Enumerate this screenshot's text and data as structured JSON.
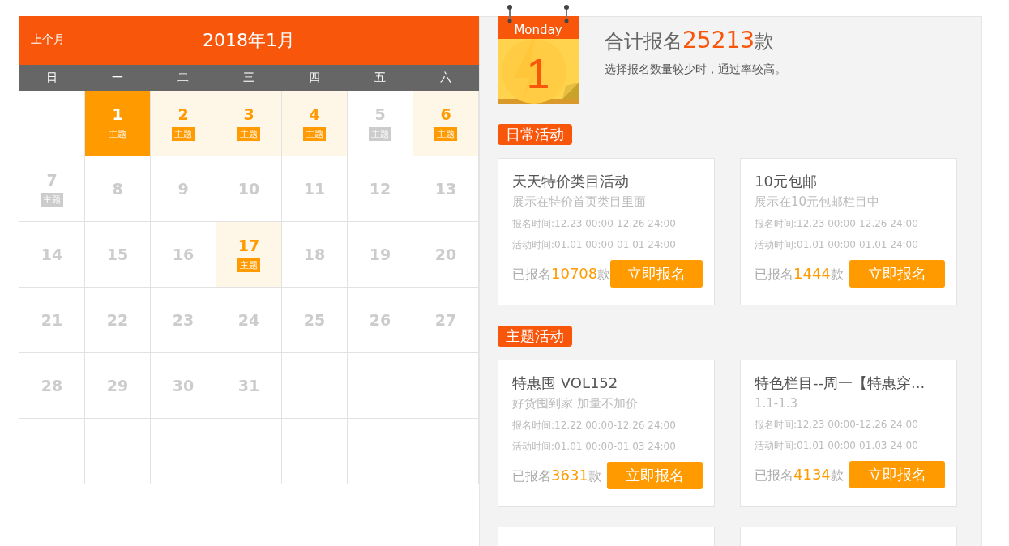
{
  "calendar": {
    "prev_link": "上个月",
    "title": "2018年1月",
    "weekdays": [
      "日",
      "一",
      "二",
      "三",
      "四",
      "五",
      "六"
    ],
    "weeks": [
      [
        {
          "kind": "blank"
        },
        {
          "kind": "day",
          "day": "1",
          "tag": "主题",
          "selected": true
        },
        {
          "kind": "day",
          "day": "2",
          "tag": "主题",
          "selected": false,
          "highlighted": true
        },
        {
          "kind": "day",
          "day": "3",
          "tag": "主题",
          "selected": false,
          "highlighted": true
        },
        {
          "kind": "day",
          "day": "4",
          "tag": "主题",
          "selected": false,
          "highlighted": true
        },
        {
          "kind": "day",
          "day": "5",
          "tag": "主题",
          "selected": false,
          "highlighted": false
        },
        {
          "kind": "day",
          "day": "6",
          "tag": "主题",
          "selected": false,
          "highlighted": true
        }
      ],
      [
        {
          "kind": "day",
          "day": "7",
          "tag": "主题",
          "selected": false,
          "highlighted": false
        },
        {
          "kind": "day",
          "day": "8",
          "selected": false,
          "highlighted": false
        },
        {
          "kind": "day",
          "day": "9",
          "selected": false,
          "highlighted": false
        },
        {
          "kind": "day",
          "day": "10",
          "selected": false,
          "highlighted": false
        },
        {
          "kind": "day",
          "day": "11",
          "selected": false,
          "highlighted": false
        },
        {
          "kind": "day",
          "day": "12",
          "selected": false,
          "highlighted": false
        },
        {
          "kind": "day",
          "day": "13",
          "selected": false,
          "highlighted": false
        }
      ],
      [
        {
          "kind": "day",
          "day": "14",
          "selected": false,
          "highlighted": false
        },
        {
          "kind": "day",
          "day": "15",
          "selected": false,
          "highlighted": false
        },
        {
          "kind": "day",
          "day": "16",
          "selected": false,
          "highlighted": false
        },
        {
          "kind": "day",
          "day": "17",
          "tag": "主题",
          "selected": false,
          "highlighted": true
        },
        {
          "kind": "day",
          "day": "18",
          "selected": false,
          "highlighted": false
        },
        {
          "kind": "day",
          "day": "19",
          "selected": false,
          "highlighted": false
        },
        {
          "kind": "day",
          "day": "20",
          "selected": false,
          "highlighted": false
        }
      ],
      [
        {
          "kind": "day",
          "day": "21",
          "selected": false,
          "highlighted": false
        },
        {
          "kind": "day",
          "day": "22",
          "selected": false,
          "highlighted": false
        },
        {
          "kind": "day",
          "day": "23",
          "selected": false,
          "highlighted": false
        },
        {
          "kind": "day",
          "day": "24",
          "selected": false,
          "highlighted": false
        },
        {
          "kind": "day",
          "day": "25",
          "selected": false,
          "highlighted": false
        },
        {
          "kind": "day",
          "day": "26",
          "selected": false,
          "highlighted": false
        },
        {
          "kind": "day",
          "day": "27",
          "selected": false,
          "highlighted": false
        }
      ],
      [
        {
          "kind": "day",
          "day": "28",
          "selected": false,
          "highlighted": false
        },
        {
          "kind": "day",
          "day": "29",
          "selected": false,
          "highlighted": false
        },
        {
          "kind": "day",
          "day": "30",
          "selected": false,
          "highlighted": false
        },
        {
          "kind": "day",
          "day": "31",
          "selected": false,
          "highlighted": false
        },
        {
          "kind": "blank"
        },
        {
          "kind": "blank"
        },
        {
          "kind": "blank"
        }
      ],
      [
        {
          "kind": "blank"
        },
        {
          "kind": "blank"
        },
        {
          "kind": "blank"
        },
        {
          "kind": "blank"
        },
        {
          "kind": "blank"
        },
        {
          "kind": "blank"
        },
        {
          "kind": "blank"
        }
      ]
    ]
  },
  "summary": {
    "icon": {
      "weekday": "Monday",
      "day": "1"
    },
    "total_prefix": "合计报名",
    "total": "25213",
    "total_suffix": "款",
    "hint": "选择报名数量较少时，通过率较高。"
  },
  "sections": [
    {
      "label": "日常活动",
      "cards": [
        {
          "kind": "full",
          "title": "天天特价类目活动",
          "description": "展示在特价首页类目里面",
          "signup_time": "报名时间:12.23 00:00-12.26 24:00",
          "event_time": "活动时间:01.01 00:00-01.01 24:00",
          "count_prefix": "已报名",
          "count": "10708",
          "count_suffix": "款",
          "button": "立即报名"
        },
        {
          "kind": "full",
          "title": "10元包邮",
          "description": "展示在10元包邮栏目中",
          "signup_time": "报名时间:12.23 00:00-12.26 24:00",
          "event_time": "活动时间:01.01 00:00-01.01 24:00",
          "count_prefix": "已报名",
          "count": "1444",
          "count_suffix": "款",
          "button": "立即报名"
        }
      ]
    },
    {
      "label": "主题活动",
      "cards": [
        {
          "kind": "full",
          "title": "特惠囤 VOL152",
          "description": "好货囤到家 加量不加价",
          "signup_time": "报名时间:12.22 00:00-12.26 24:00",
          "event_time": "活动时间:01.01 00:00-01.03 24:00",
          "count_prefix": "已报名",
          "count": "3631",
          "count_suffix": "款",
          "button": "立即报名"
        },
        {
          "kind": "full",
          "title": "特色栏目--周一【特惠穿...",
          "description": "1.1-1.3",
          "signup_time": "报名时间:12.23 00:00-12.26 24:00",
          "event_time": "活动时间:01.01 00:00-01.03 24:00",
          "count_prefix": "已报名",
          "count": "4134",
          "count_suffix": "款",
          "button": "立即报名"
        },
        {
          "kind": "cut_off"
        },
        {
          "kind": "cut_off"
        }
      ]
    }
  ]
}
